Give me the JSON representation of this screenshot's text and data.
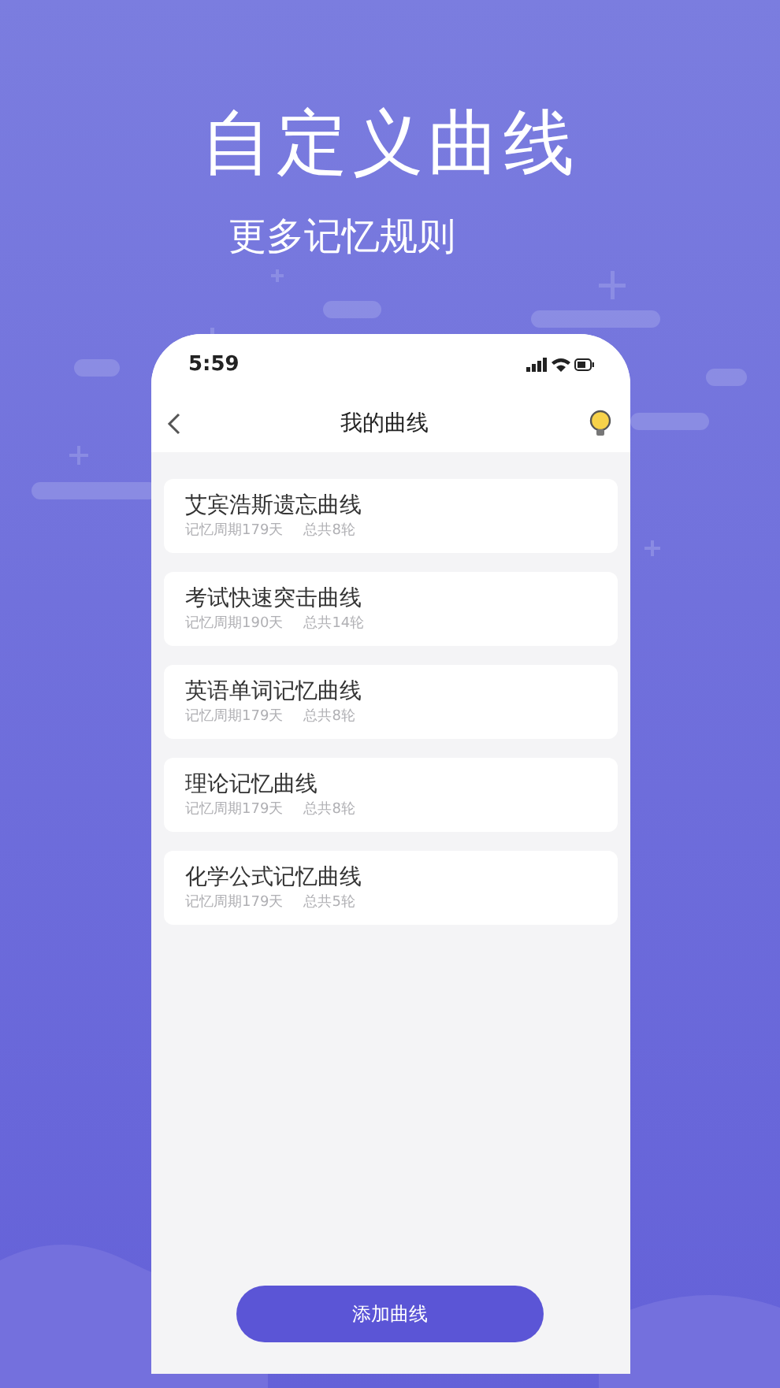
{
  "headline": "自定义曲线",
  "subheadline": "更多记忆规则",
  "phone": {
    "status_bar": {
      "time": "5:59"
    },
    "nav": {
      "title": "我的曲线"
    },
    "curves": [
      {
        "name": "艾宾浩斯遗忘曲线",
        "period": "记忆周期179天",
        "rounds": "总共8轮"
      },
      {
        "name": "考试快速突击曲线",
        "period": "记忆周期190天",
        "rounds": "总共14轮"
      },
      {
        "name": "英语单词记忆曲线",
        "period": "记忆周期179天",
        "rounds": "总共8轮"
      },
      {
        "name": "理论记忆曲线",
        "period": "记忆周期179天",
        "rounds": "总共8轮"
      },
      {
        "name": "化学公式记忆曲线",
        "period": "记忆周期179天",
        "rounds": "总共5轮"
      }
    ],
    "button": "添加曲线"
  }
}
